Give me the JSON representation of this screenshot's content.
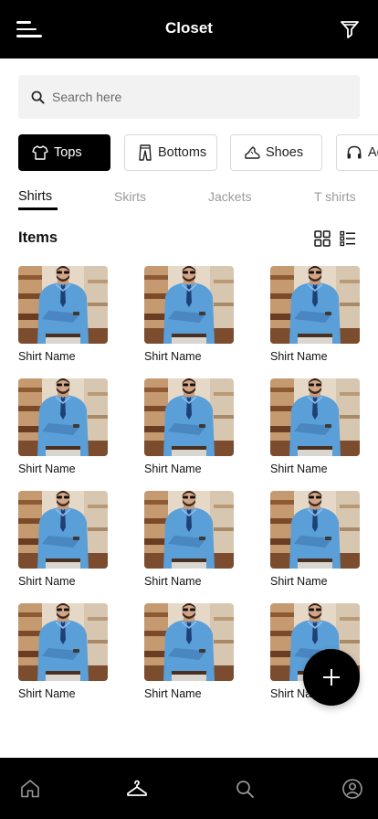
{
  "header": {
    "title": "Closet",
    "menu_icon": "hamburger-menu-icon",
    "filter_icon": "filter-icon"
  },
  "search": {
    "placeholder": "Search here",
    "value": "",
    "icon": "search-icon"
  },
  "categories": [
    {
      "label": "Tops",
      "icon": "tshirt-icon",
      "active": true
    },
    {
      "label": "Bottoms",
      "icon": "pants-icon",
      "active": false
    },
    {
      "label": "Shoes",
      "icon": "shoe-icon",
      "active": false
    },
    {
      "label": "Accessories",
      "icon": "headphones-icon",
      "active": false
    }
  ],
  "subtabs": [
    {
      "label": "Shirts",
      "active": true
    },
    {
      "label": "Skirts",
      "active": false
    },
    {
      "label": "Jackets",
      "active": false
    },
    {
      "label": "T shirts",
      "active": false
    }
  ],
  "section": {
    "title": "Items",
    "grid_view_icon": "grid-view-icon",
    "list_view_icon": "list-view-icon"
  },
  "items": [
    {
      "name": "Shirt Name"
    },
    {
      "name": "Shirt Name"
    },
    {
      "name": "Shirt Name"
    },
    {
      "name": "Shirt Name"
    },
    {
      "name": "Shirt Name"
    },
    {
      "name": "Shirt Name"
    },
    {
      "name": "Shirt Name"
    },
    {
      "name": "Shirt Name"
    },
    {
      "name": "Shirt Name"
    },
    {
      "name": "Shirt Name"
    },
    {
      "name": "Shirt Name"
    },
    {
      "name": "Shirt Name"
    }
  ],
  "fab": {
    "icon": "plus-icon"
  },
  "bottom_nav": [
    {
      "icon": "home-icon"
    },
    {
      "icon": "hanger-icon",
      "active": true
    },
    {
      "icon": "search-icon"
    },
    {
      "icon": "profile-icon"
    }
  ],
  "colors": {
    "bar": "#000000",
    "accent": "#000000",
    "search_bg": "#f2f2f2",
    "shirt": "#5b9fd8"
  }
}
